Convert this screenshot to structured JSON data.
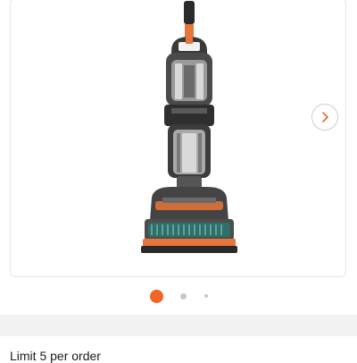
{
  "gallery": {
    "image_alt": "Upright carpet cleaner vacuum",
    "next_icon": "chevron-right-icon",
    "slide_count": 3,
    "active_slide": 1
  },
  "order": {
    "limit_text": "Limit 5 per order"
  },
  "colors": {
    "accent": "#f26522",
    "dot_inactive": "#c8c8c8",
    "divider_band": "#f2f2f2"
  }
}
